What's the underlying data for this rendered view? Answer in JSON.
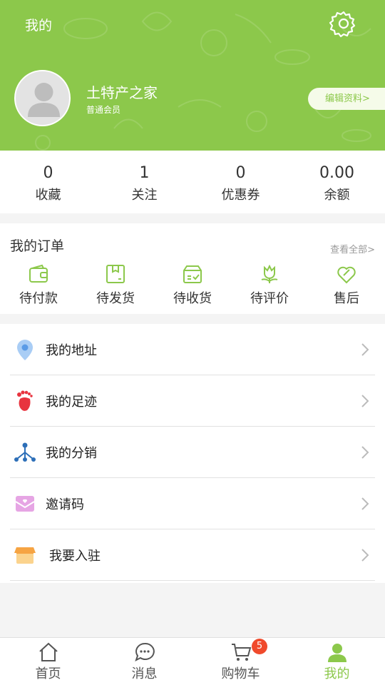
{
  "header": {
    "title": "我的",
    "settings_icon": "gear-icon",
    "user_name": "土特产之家",
    "user_level": "普通会员",
    "edit_profile": "编辑资料>",
    "bg_color": "#8cc84b"
  },
  "stats": [
    {
      "value": "0",
      "label": "收藏"
    },
    {
      "value": "1",
      "label": "关注"
    },
    {
      "value": "0",
      "label": "优惠券"
    },
    {
      "value": "0.00",
      "label": "余额"
    }
  ],
  "orders": {
    "title": "我的订单",
    "view_all": "查看全部>",
    "items": [
      {
        "label": "待付款",
        "icon": "wallet-icon"
      },
      {
        "label": "待发货",
        "icon": "package-icon"
      },
      {
        "label": "待收货",
        "icon": "delivery-box-icon"
      },
      {
        "label": "待评价",
        "icon": "flower-icon"
      },
      {
        "label": "售后",
        "icon": "heart-wrench-icon"
      }
    ]
  },
  "menu": [
    {
      "label": "我的地址",
      "icon": "location-pin-icon"
    },
    {
      "label": "我的足迹",
      "icon": "footprint-icon"
    },
    {
      "label": "我的分销",
      "icon": "network-icon"
    },
    {
      "label": "邀请码",
      "icon": "envelope-icon"
    },
    {
      "label": "我要入驻",
      "icon": "shop-icon"
    }
  ],
  "tabbar": {
    "items": [
      {
        "label": "首页",
        "icon": "home-icon"
      },
      {
        "label": "消息",
        "icon": "message-icon"
      },
      {
        "label": "购物车",
        "icon": "cart-icon"
      },
      {
        "label": "我的",
        "icon": "user-icon"
      }
    ],
    "cart_badge": "5",
    "active_color": "#8cc84b",
    "badge_color": "#f04a2c"
  }
}
